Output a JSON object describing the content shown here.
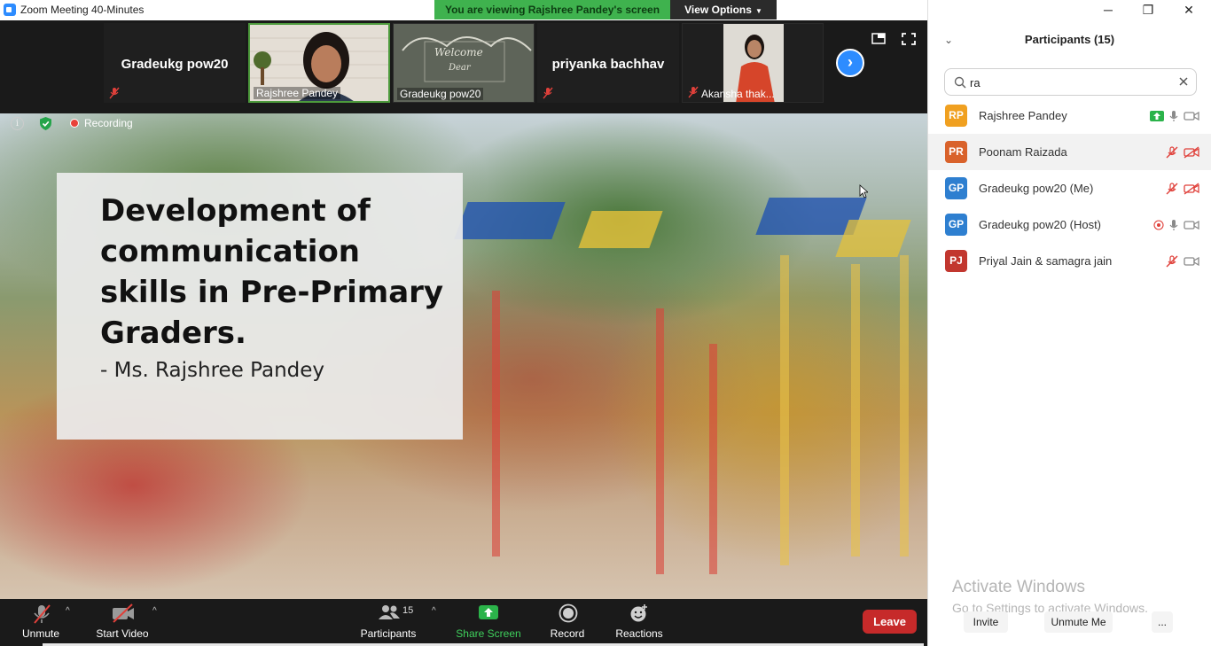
{
  "window": {
    "title": "Zoom Meeting 40-Minutes",
    "controls": {
      "minimize": "─",
      "restore": "❐",
      "close": "✕"
    }
  },
  "banner": {
    "viewing_text": "You are viewing Rajshree Pandey's screen",
    "view_options_label": "View Options"
  },
  "thumbnails": [
    {
      "name": "Gradeukg pow20",
      "type": "name-only",
      "muted": true
    },
    {
      "name": "Rajshree Pandey",
      "type": "video",
      "active": true
    },
    {
      "name": "Gradeukg pow20",
      "type": "video"
    },
    {
      "name": "priyanka bachhav",
      "type": "name-only",
      "muted": true
    },
    {
      "name": "Akansha thak...",
      "type": "video",
      "muted": true
    }
  ],
  "screen": {
    "recording_label": "Recording",
    "slide_title": "Development of communication skills in Pre-Primary Graders.",
    "slide_author": "- Ms. Rajshree Pandey"
  },
  "toolbar": {
    "unmute": "Unmute",
    "start_video": "Start Video",
    "participants": "Participants",
    "participants_count": "15",
    "share_screen": "Share Screen",
    "record": "Record",
    "reactions": "Reactions",
    "leave": "Leave"
  },
  "panel": {
    "title": "Participants (15)",
    "search_value": "ra",
    "participants": [
      {
        "initials": "RP",
        "name": "Rajshree Pandey",
        "color": "#f0a020",
        "highlight": false,
        "sharing": true,
        "recording": false,
        "mic_muted": false,
        "video_off": false
      },
      {
        "initials": "PR",
        "name": "Poonam Raizada",
        "color": "#d9622b",
        "highlight": true,
        "sharing": false,
        "recording": false,
        "mic_muted": true,
        "video_off": true
      },
      {
        "initials": "GP",
        "name": "Gradeukg pow20 (Me)",
        "color": "#2e7fd0",
        "highlight": false,
        "sharing": false,
        "recording": false,
        "mic_muted": true,
        "video_off": true
      },
      {
        "initials": "GP",
        "name": "Gradeukg pow20 (Host)",
        "color": "#2e7fd0",
        "highlight": false,
        "sharing": false,
        "recording": true,
        "mic_muted": false,
        "video_off": false
      },
      {
        "initials": "PJ",
        "name": "Priyal Jain & samagra jain",
        "color": "#c2372f",
        "highlight": false,
        "sharing": false,
        "recording": false,
        "mic_muted": true,
        "video_off": false
      }
    ],
    "activate_line1": "Activate Windows",
    "activate_line2": "Go to Settings to activate Windows.",
    "invite": "Invite",
    "unmute_me": "Unmute Me",
    "more": "..."
  }
}
